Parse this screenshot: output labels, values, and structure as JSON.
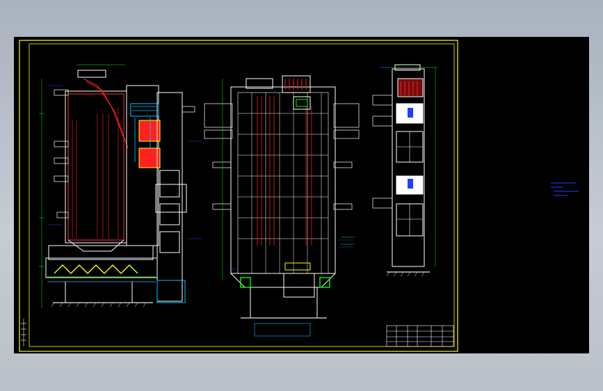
{
  "drawing": {
    "title_block_label": "",
    "notes": [],
    "colors": {
      "background": "#000000",
      "frame": "#ffff00",
      "structure": "#ffffff",
      "tubes": "#ff2020",
      "water": "#00c8ff",
      "dimension": "#00ff00",
      "annotation": "#2040ff",
      "ground": "#c0c0c0"
    }
  }
}
